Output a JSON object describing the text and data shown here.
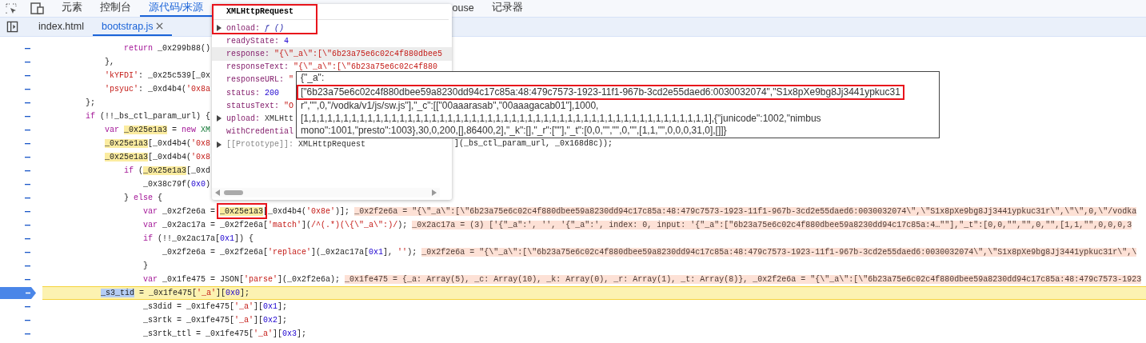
{
  "toolbar": {
    "tabs": [
      {
        "label": "元素",
        "selected": false
      },
      {
        "label": "控制台",
        "selected": false
      },
      {
        "label": "源代码/来源",
        "selected": true
      },
      {
        "label": "ouse",
        "selected": false
      },
      {
        "label": "记录器",
        "selected": false
      }
    ]
  },
  "file_tabs": [
    {
      "label": "index.html",
      "selected": false,
      "closable": false
    },
    {
      "label": "bootstrap.js",
      "selected": true,
      "closable": true
    }
  ],
  "code": {
    "lines": [
      {
        "current": false,
        "tokens": [
          {
            "kind": "keyword",
            "text": "        return"
          },
          {
            "kind": "plain",
            "text": " _0x299b88()"
          }
        ]
      },
      {
        "current": false,
        "tokens": [
          {
            "kind": "plain",
            "text": "    },"
          }
        ]
      },
      {
        "current": false,
        "tokens": [
          {
            "kind": "string",
            "text": "    'kYFDI'"
          },
          {
            "kind": "plain",
            "text": ": _0x25c539[_0x"
          }
        ]
      },
      {
        "current": false,
        "tokens": [
          {
            "kind": "string",
            "text": "    'psyuc'"
          },
          {
            "kind": "plain",
            "text": ": _0xd4b4("
          },
          {
            "kind": "string",
            "text": "'0x8a"
          }
        ]
      },
      {
        "current": false,
        "tokens": [
          {
            "kind": "plain",
            "text": "};"
          }
        ]
      },
      {
        "current": false,
        "tokens": [
          {
            "kind": "keyword",
            "text": "if"
          },
          {
            "kind": "plain",
            "text": " (!!_bs_ctl_param_url) {"
          }
        ]
      },
      {
        "current": false,
        "tokens": [
          {
            "kind": "keyword",
            "text": "    var "
          },
          {
            "kind": "highlight",
            "text": "_0x25e1a3"
          },
          {
            "kind": "plain",
            "text": " = "
          },
          {
            "kind": "keyword",
            "text": "new "
          },
          {
            "kind": "class",
            "text": "XM"
          }
        ]
      },
      {
        "current": false,
        "tokens": [
          {
            "kind": "highlight",
            "text": "    _0x25e1a3"
          },
          {
            "kind": "plain",
            "text": "[_0xd4b4("
          },
          {
            "kind": "string",
            "text": "'0x8"
          }
        ],
        "tail": "](_bs_ctl_param_url, _0x168d8c));"
      },
      {
        "current": false,
        "tokens": [
          {
            "kind": "highlight",
            "text": "    _0x25e1a3"
          },
          {
            "kind": "plain",
            "text": "[_0xd4b4("
          },
          {
            "kind": "string",
            "text": "'0x8"
          }
        ]
      },
      {
        "current": false,
        "tokens": [
          {
            "kind": "keyword",
            "text": "        if"
          },
          {
            "kind": "plain",
            "text": " ("
          },
          {
            "kind": "highlight",
            "text": "_0x25e1a3"
          },
          {
            "kind": "plain",
            "text": "[_0xd"
          }
        ]
      },
      {
        "current": false,
        "tokens": [
          {
            "kind": "plain",
            "text": "            _0x38c79f("
          },
          {
            "kind": "number",
            "text": "0x0"
          },
          {
            "kind": "plain",
            "text": ")"
          }
        ]
      },
      {
        "current": false,
        "tokens": [
          {
            "kind": "plain",
            "text": "        } "
          },
          {
            "kind": "keyword",
            "text": "else"
          },
          {
            "kind": "plain",
            "text": " {"
          }
        ]
      },
      {
        "current": false,
        "tokens": [
          {
            "kind": "keyword",
            "text": "            var"
          },
          {
            "kind": "plain",
            "text": " _0x2f2e6a = "
          },
          {
            "kind": "highlight",
            "text": "_0x25e1a3"
          },
          {
            "kind": "plain",
            "text": "[_0xd4b4("
          },
          {
            "kind": "string",
            "text": "'0x8e'"
          },
          {
            "kind": "plain",
            "text": ")];"
          }
        ],
        "annotation": "_0x2f2e6a = \"{\\\"_a\\\":[\\\"6b23a75e6c02c4f880dbee59a8230dd94c17c85a:48:479c7573-1923-11f1-967b-3cd2e55daed6:0030032074\\\",\\\"S1x8pXe9bg8Jj3441ypkuc31r\\\",\\\"\\\",0,\\\"/vodka"
      },
      {
        "current": false,
        "tokens": [
          {
            "kind": "keyword",
            "text": "            var"
          },
          {
            "kind": "plain",
            "text": " _0x2ac17a = _0x2f2e6a["
          },
          {
            "kind": "string",
            "text": "'match'"
          },
          {
            "kind": "plain",
            "text": "]("
          },
          {
            "kind": "string",
            "text": "/^(.*)(\\{\\\"_a\\\":)/"
          },
          {
            "kind": "plain",
            "text": ");"
          }
        ],
        "annotation": "_0x2ac17a = (3) ['{\"_a\":', '', '{\"_a\":', index: 0, input: '{\"_a\":[\"6b23a75e6c02c4f880dbee59a8230dd94c17c85a:4…\"\"],\"_t\":[0,0,\"\",\"\",0,\"\",[1,1,\"\",0,0,0,3"
      },
      {
        "current": false,
        "tokens": [
          {
            "kind": "keyword",
            "text": "            if"
          },
          {
            "kind": "plain",
            "text": " (!!_0x2ac17a["
          },
          {
            "kind": "number",
            "text": "0x1"
          },
          {
            "kind": "plain",
            "text": "]) {"
          }
        ]
      },
      {
        "current": false,
        "tokens": [
          {
            "kind": "plain",
            "text": "                _0x2f2e6a = _0x2f2e6a["
          },
          {
            "kind": "string",
            "text": "'replace'"
          },
          {
            "kind": "plain",
            "text": "](_0x2ac17a["
          },
          {
            "kind": "number",
            "text": "0x1"
          },
          {
            "kind": "plain",
            "text": "], "
          },
          {
            "kind": "string",
            "text": "''"
          },
          {
            "kind": "plain",
            "text": ");"
          }
        ],
        "annotation": "_0x2f2e6a = \"{\\\"_a\\\":[\\\"6b23a75e6c02c4f880dbee59a8230dd94c17c85a:48:479c7573-1923-11f1-967b-3cd2e55daed6:0030032074\\\",\\\"S1x8pXe9bg8Jj3441ypkuc31r\\\",\\"
      },
      {
        "current": false,
        "tokens": [
          {
            "kind": "plain",
            "text": "            }"
          }
        ]
      },
      {
        "current": false,
        "tokens": [
          {
            "kind": "keyword",
            "text": "            var"
          },
          {
            "kind": "plain",
            "text": " _0x1fe475 = JSON["
          },
          {
            "kind": "string",
            "text": "'parse'"
          },
          {
            "kind": "plain",
            "text": "](_0x2f2e6a);"
          }
        ],
        "annotation": "_0x1fe475 = {_a: Array(5), _c: Array(10), _k: Array(0), _r: Array(1), _t: Array(8)}, _0x2f2e6a = \"{\\\"_a\\\":[\\\"6b23a75e6c02c4f880dbee59a8230dd94c17c85a:48:479c7573-1923"
      },
      {
        "current": true,
        "tokens": [
          {
            "kind": "selection",
            "text": "            _s3_tid"
          },
          {
            "kind": "plain",
            "text": " = _0x1fe475["
          },
          {
            "kind": "string",
            "text": "'_a'"
          },
          {
            "kind": "plain",
            "text": "]["
          },
          {
            "kind": "number",
            "text": "0x0"
          },
          {
            "kind": "plain",
            "text": "];"
          }
        ]
      },
      {
        "current": false,
        "tokens": [
          {
            "kind": "plain",
            "text": "            _s3did = _0x1fe475["
          },
          {
            "kind": "string",
            "text": "'_a'"
          },
          {
            "kind": "plain",
            "text": "]["
          },
          {
            "kind": "number",
            "text": "0x1"
          },
          {
            "kind": "plain",
            "text": "];"
          }
        ]
      },
      {
        "current": false,
        "tokens": [
          {
            "kind": "plain",
            "text": "            _s3rtk = _0x1fe475["
          },
          {
            "kind": "string",
            "text": "'_a'"
          },
          {
            "kind": "plain",
            "text": "]["
          },
          {
            "kind": "number",
            "text": "0x2"
          },
          {
            "kind": "plain",
            "text": "];"
          }
        ]
      },
      {
        "current": false,
        "tokens": [
          {
            "kind": "plain",
            "text": "            _s3rtk_ttl = _0x1fe475["
          },
          {
            "kind": "string",
            "text": "'_a'"
          },
          {
            "kind": "plain",
            "text": "]["
          },
          {
            "kind": "number",
            "text": "0x3"
          },
          {
            "kind": "plain",
            "text": "];"
          }
        ]
      }
    ]
  },
  "popover": {
    "title": "XMLHttpRequest",
    "properties": [
      {
        "name": "onload:",
        "value": "ƒ ()",
        "kind": "function",
        "expandable": true,
        "hovered": false
      },
      {
        "name": "readyState:",
        "value": "4",
        "kind": "number",
        "expandable": false,
        "hovered": false
      },
      {
        "name": "response:",
        "value": "\"{\\\"_a\\\":[\\\"6b23a75e6c02c4f880dbee5",
        "kind": "string",
        "expandable": false,
        "hovered": true
      },
      {
        "name": "responseText:",
        "value": "\"{\\\"_a\\\":[\\\"6b23a75e6c02c4f880",
        "kind": "string",
        "expandable": false,
        "hovered": false
      },
      {
        "name": "responseURL:",
        "value": "\"",
        "kind": "string",
        "expandable": false,
        "hovered": false
      },
      {
        "name": "status:",
        "value": "200",
        "kind": "number",
        "expandable": false,
        "hovered": false
      },
      {
        "name": "statusText:",
        "value": "\"O",
        "kind": "string",
        "expandable": false,
        "hovered": false
      },
      {
        "name": "upload:",
        "value": "XMLHtt",
        "kind": "object",
        "expandable": true,
        "hovered": false
      },
      {
        "name": "withCredential",
        "kind": "object",
        "expandable": false,
        "hovered": false
      },
      {
        "name": "[[Prototype]]:",
        "value": "XMLHttpRequest",
        "kind": "internal",
        "expandable": true,
        "hovered": false
      }
    ]
  },
  "tooltip": {
    "lines": [
      "{\"_a\":",
      "[\"6b23a75e6c02c4f880dbee59a8230dd94c17c85a:48:479c7573-1923-11f1-967b-3cd2e55daed6:0030032074\",\"S1x8pXe9bg8Jj3441ypkuc31",
      "r\",\"\",0,\"/vodka/v1/js/sw.js\"],\"_c\":[[\"00aaarasab\",\"00aaagacab01\"],1000,",
      "[1,1,1,1,1,1,1,1,1,1,1,1,1,1,1,1,1,1,1,1,1,1,1,1,1,1,1,1,1,1,1,1,1,1,1,1,1,1,1,1,1,1,1,1,1,1,1,1,1,1,1],{\"junicode\":1002,\"nimbus",
      "mono\":1001,\"presto\":1003},30,0,200,[],86400,2],\"_k\":[],\"_r\":[\"\"],\"_t\":[0,0,\"\",\"\",0,\"\",[1,1,\"\",0,0,0,31,0],[]]}"
    ]
  }
}
